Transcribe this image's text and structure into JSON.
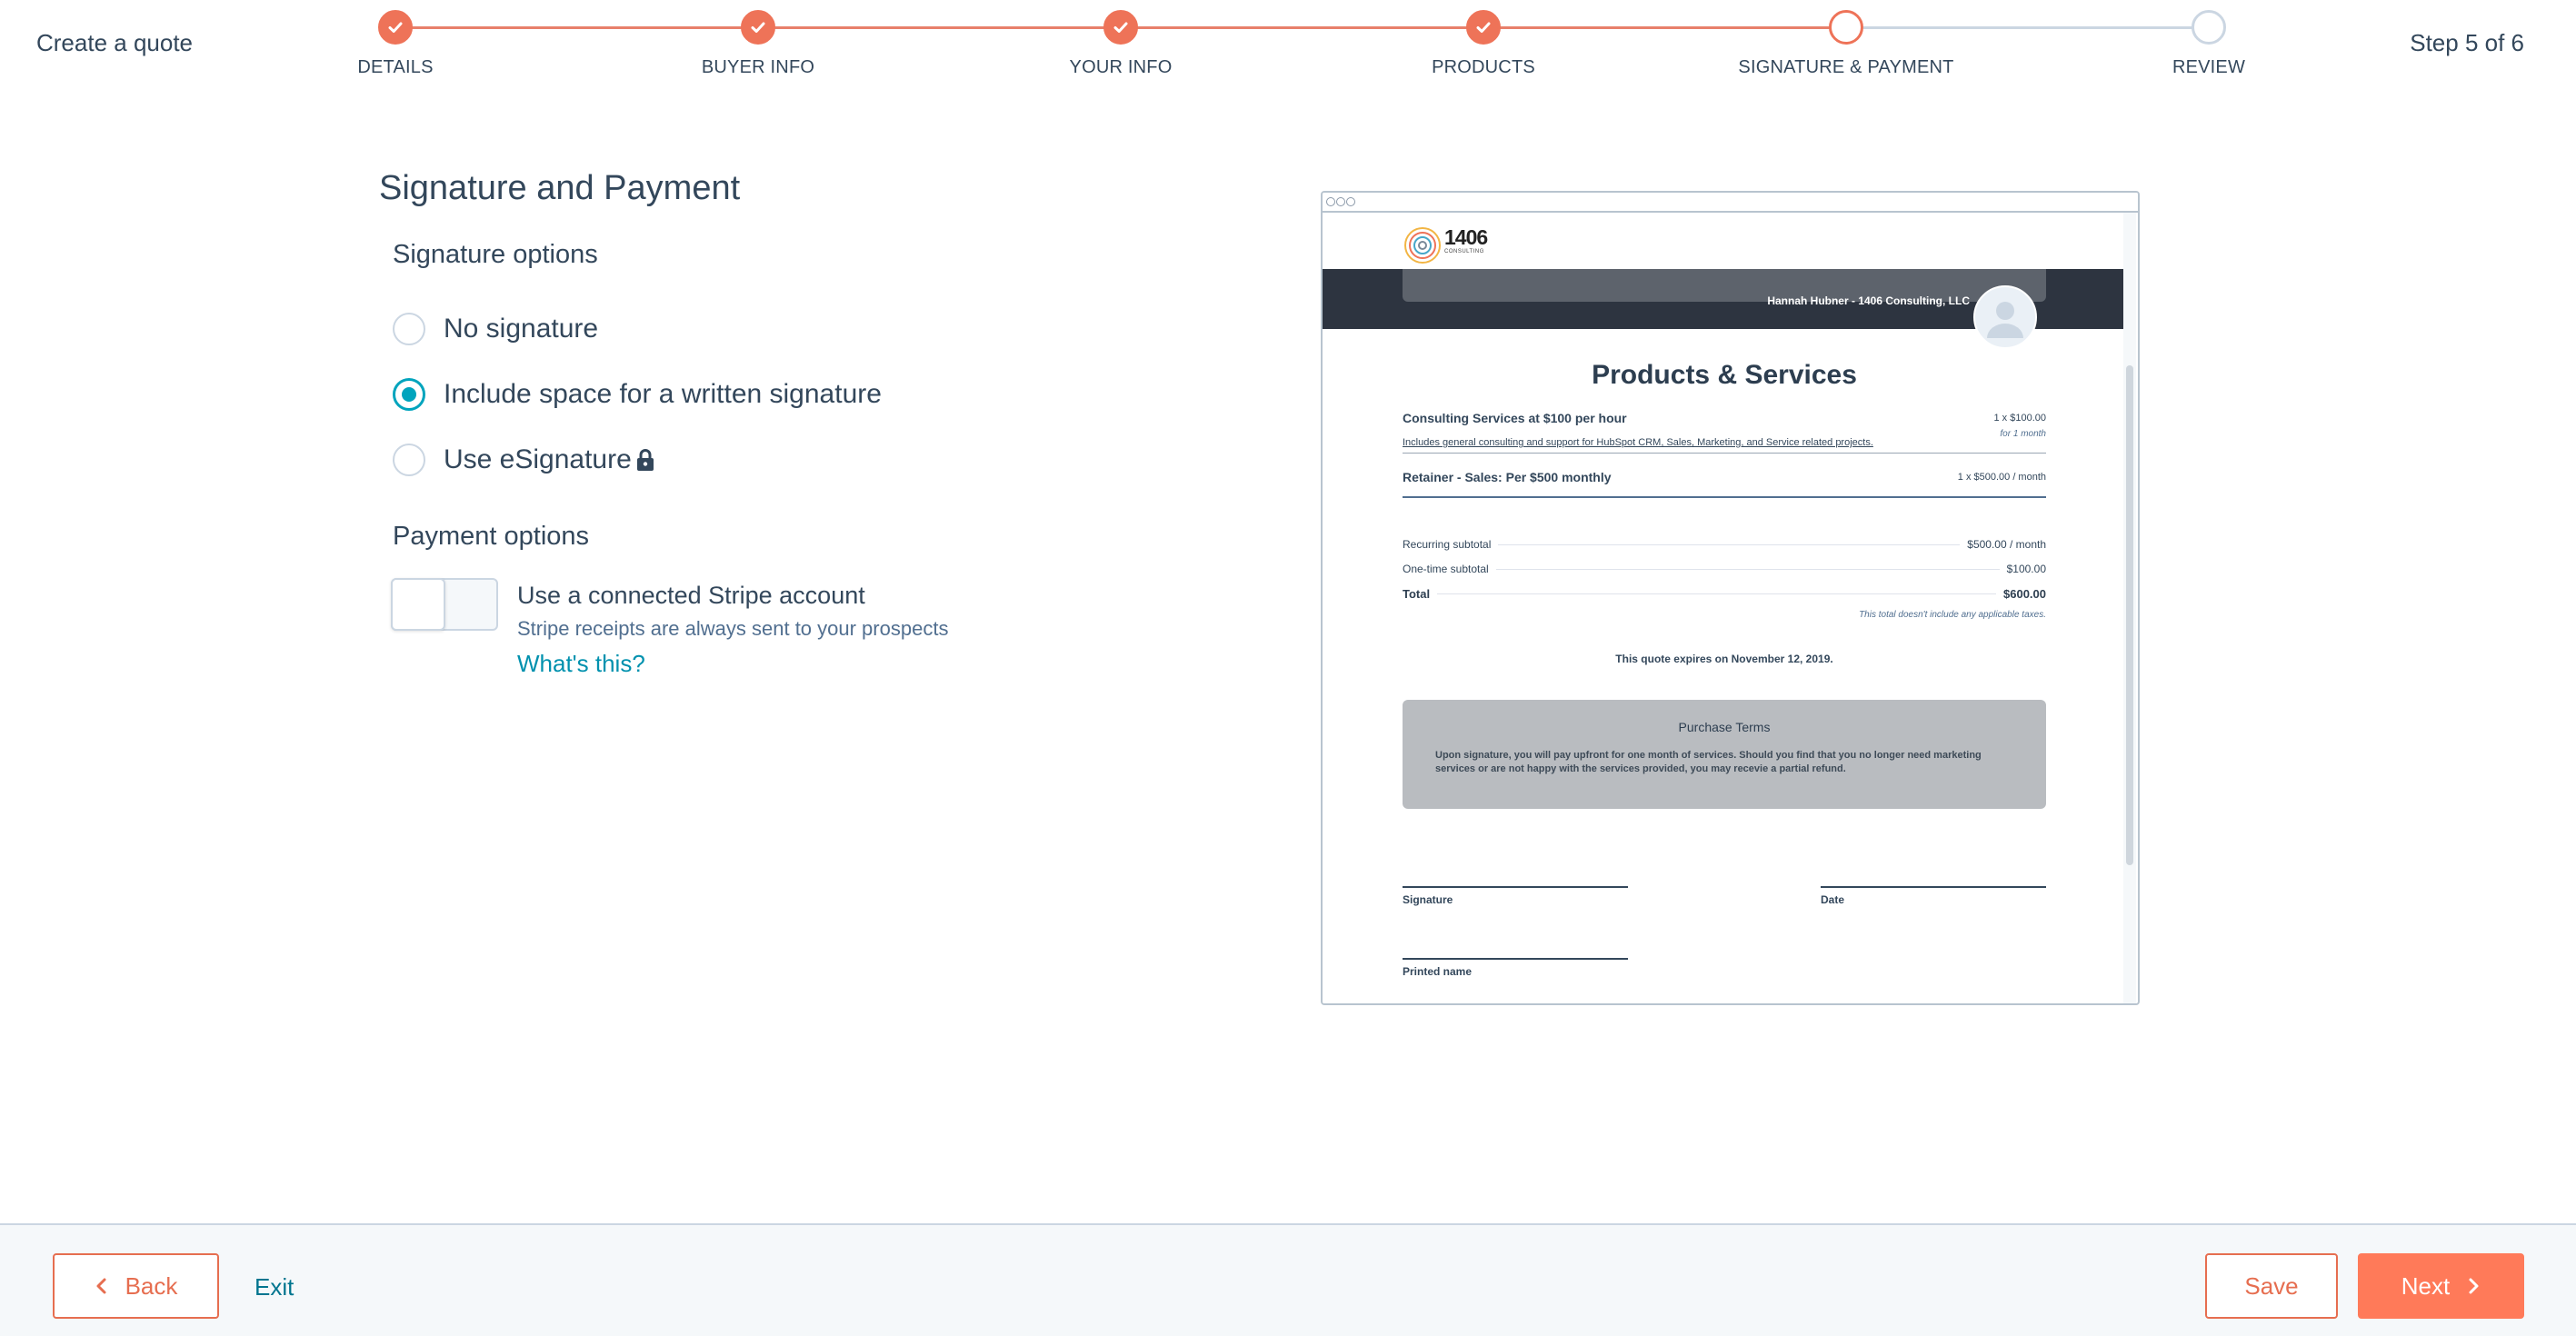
{
  "header": {
    "title": "Create a quote",
    "step_indicator": "Step 5 of 6",
    "steps": [
      {
        "label": "DETAILS",
        "state": "complete"
      },
      {
        "label": "BUYER INFO",
        "state": "complete"
      },
      {
        "label": "YOUR INFO",
        "state": "complete"
      },
      {
        "label": "PRODUCTS",
        "state": "complete"
      },
      {
        "label": "SIGNATURE & PAYMENT",
        "state": "current"
      },
      {
        "label": "REVIEW",
        "state": "upcoming"
      }
    ]
  },
  "main": {
    "heading": "Signature and Payment",
    "signature": {
      "heading": "Signature options",
      "options": [
        {
          "label": "No signature",
          "checked": false
        },
        {
          "label": "Include space for a written signature",
          "checked": true
        },
        {
          "label": "Use eSignature",
          "checked": false,
          "icon": "lock-icon"
        }
      ]
    },
    "payment": {
      "heading": "Payment options",
      "toggle_on": false,
      "stripe_label": "Use a connected Stripe account",
      "stripe_help": "Stripe receipts are always sent to your prospects",
      "whats_this": "What's this?"
    }
  },
  "preview": {
    "logo_text": "1406",
    "logo_sub": "CONSULTING",
    "sender": "Hannah Hubner - 1406 Consulting, LLC",
    "title": "Products & Services",
    "line_items": [
      {
        "name": "Consulting Services at $100 per hour",
        "amount": "1 x $100.00",
        "period": "for 1 month",
        "description": "Includes general consulting and support for HubSpot CRM, Sales, Marketing, and Service related projects."
      },
      {
        "name": "Retainer - Sales: Per $500 monthly",
        "amount": "1 x $500.00 / month"
      }
    ],
    "summary": [
      {
        "label": "Recurring subtotal",
        "value": "$500.00 / month"
      },
      {
        "label": "One-time subtotal",
        "value": "$100.00"
      },
      {
        "label": "Total",
        "value": "$600.00"
      }
    ],
    "tax_note": "This total doesn't include any applicable taxes.",
    "expires": "This quote expires on November 12, 2019.",
    "terms_title": "Purchase Terms",
    "terms_body": "Upon signature, you will pay upfront for one month of services. Should you find that you no longer need marketing services or are not happy with the services provided, you may recevie a partial refund.",
    "signature_label": "Signature",
    "date_label": "Date",
    "printed_name_label": "Printed name"
  },
  "footer": {
    "back": "Back",
    "exit": "Exit",
    "save": "Save",
    "next": "Next"
  },
  "colors": {
    "accent": "#ff7a59",
    "step_complete": "#ee7358",
    "radio_selected": "#00a4bd",
    "link": "#0091ae",
    "text": "#33475b"
  }
}
